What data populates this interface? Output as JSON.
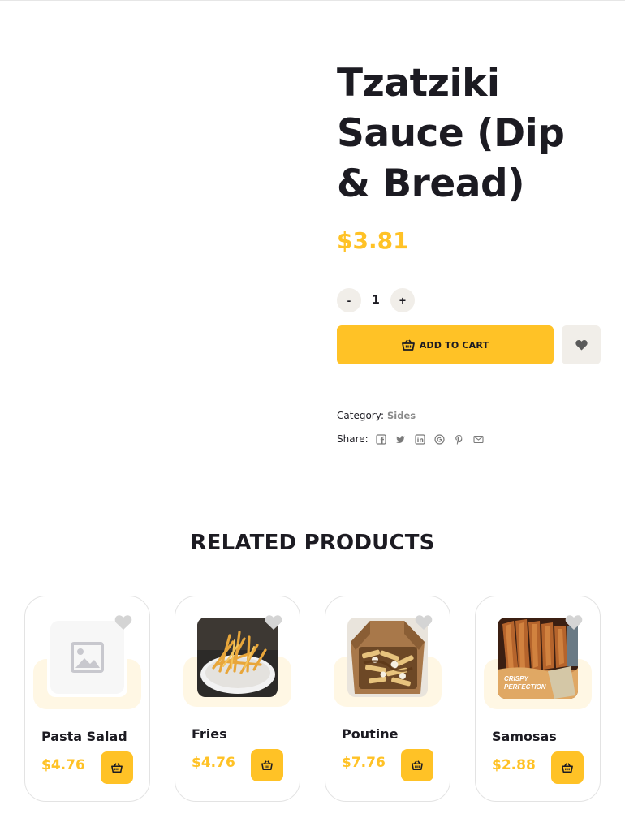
{
  "product": {
    "title": "Tzatziki Sauce (Dip & Bread)",
    "price": "$3.81",
    "quantity": "1",
    "qty_minus_label": "-",
    "qty_plus_label": "+",
    "add_to_cart_label": "ADD TO CART",
    "category_label": "Category:",
    "category_value": "Sides",
    "share_label": "Share:",
    "share_icons": [
      "facebook-icon",
      "twitter-icon",
      "linkedin-icon",
      "google-icon",
      "pinterest-icon",
      "email-icon"
    ]
  },
  "related": {
    "title": "RELATED PRODUCTS",
    "items": [
      {
        "name": "Pasta Salad",
        "price": "$4.76",
        "image": "placeholder-image-icon"
      },
      {
        "name": "Fries",
        "price": "$4.76",
        "image": "fries-photo"
      },
      {
        "name": "Poutine",
        "price": "$7.76",
        "image": "poutine-photo"
      },
      {
        "name": "Samosas",
        "price": "$2.88",
        "image": "samosas-photo",
        "image_caption": "CRISPY PERFECTION"
      }
    ]
  },
  "colors": {
    "accent": "#ffc226",
    "text": "#1c1b22",
    "muted_button": "#f1eee9",
    "card_tint": "#fff7e4"
  }
}
